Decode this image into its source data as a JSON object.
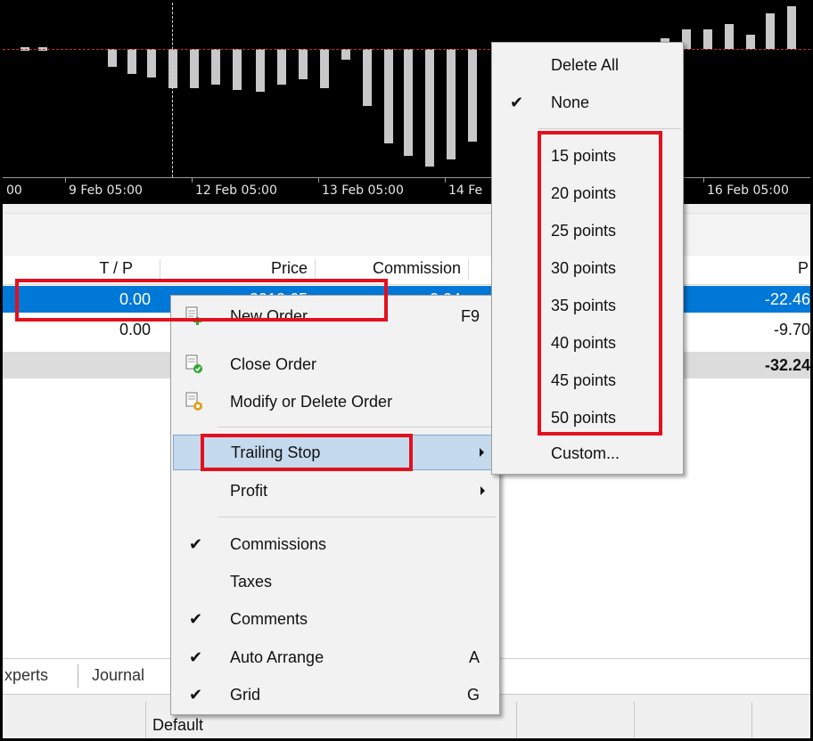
{
  "chart": {
    "time_labels": [
      "00",
      "9 Feb 05:00",
      "12 Feb 05:00",
      "13 Feb 05:00",
      "14 Fe",
      "16 Feb 05:00"
    ]
  },
  "table": {
    "headers": {
      "tp": "T / P",
      "price": "Price",
      "commission": "Commission",
      "profit": "P"
    },
    "rows": [
      {
        "tp": "0.00",
        "price": "2013.65",
        "commission": "0.04",
        "profit": "-22.46"
      },
      {
        "tp": "0.00",
        "price": "",
        "commission": "",
        "profit": "-9.70"
      }
    ],
    "total_profit": "-32.24"
  },
  "tabs": {
    "experts": "xperts",
    "journal": "Journal"
  },
  "status": {
    "profile": "Default"
  },
  "context_menu": {
    "new_order": {
      "label": "New Order",
      "shortcut": "F9"
    },
    "close_order": {
      "label": "Close Order"
    },
    "modify_order": {
      "label": "Modify or Delete Order"
    },
    "trailing_stop": {
      "label": "Trailing Stop"
    },
    "profit": {
      "label": "Profit"
    },
    "commissions": {
      "label": "Commissions",
      "checked": true
    },
    "taxes": {
      "label": "Taxes",
      "checked": false
    },
    "comments": {
      "label": "Comments",
      "checked": true
    },
    "auto_arrange": {
      "label": "Auto Arrange",
      "shortcut": "A",
      "checked": true
    },
    "grid": {
      "label": "Grid",
      "shortcut": "G",
      "checked": true
    }
  },
  "trailing_submenu": {
    "delete_all": "Delete All",
    "none": "None",
    "points": [
      "15 points",
      "20 points",
      "25 points",
      "30 points",
      "35 points",
      "40 points",
      "45 points",
      "50 points"
    ],
    "custom": "Custom..."
  },
  "check_glyph": "✔",
  "colors": {
    "selection": "#0078d7",
    "highlight": "#e3101e",
    "menu_hover": "#c5daed"
  }
}
